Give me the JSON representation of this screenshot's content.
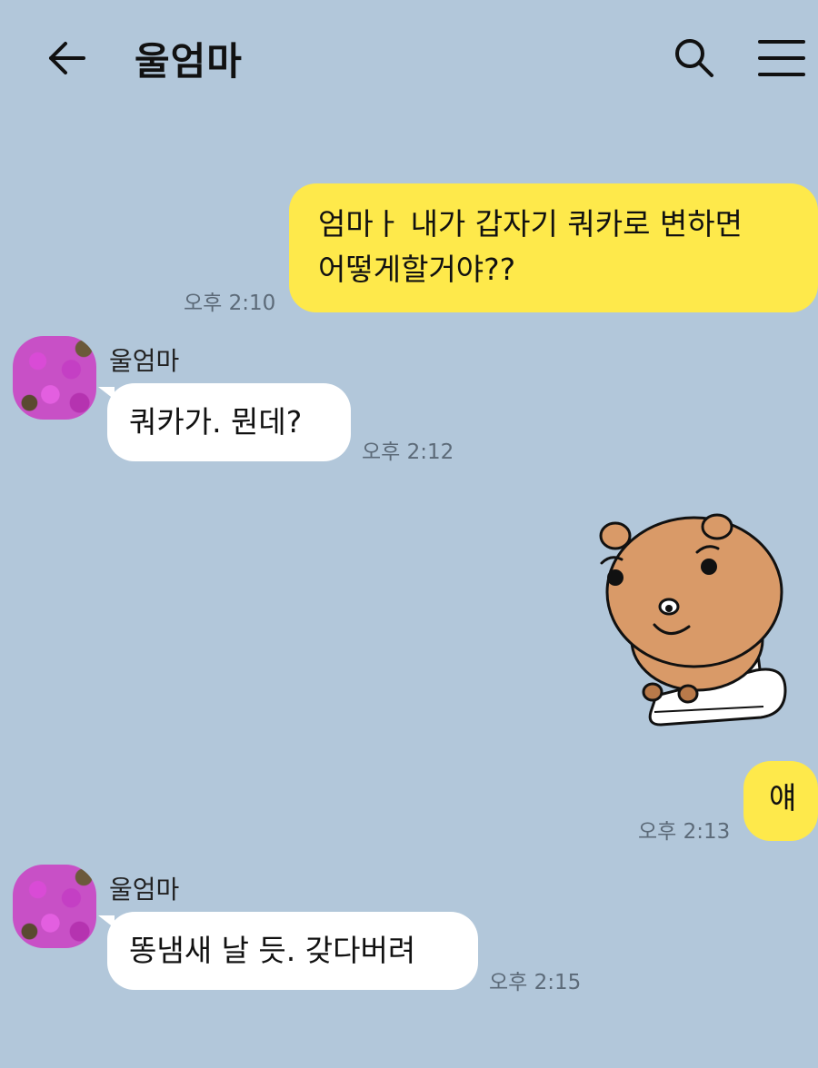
{
  "header": {
    "title": "울엄마",
    "back_icon": "arrow-left-icon",
    "search_icon": "search-icon",
    "menu_icon": "menu-icon"
  },
  "messages": [
    {
      "side": "mine",
      "lines": [
        "엄마ㅏ 내가 갑자기 쿼카로 변하면",
        "어떻게할거야??"
      ],
      "time": "오후 2:10"
    },
    {
      "side": "theirs",
      "sender": "울엄마",
      "text": "쿼카가. 뭔데?",
      "time": "오후 2:12"
    },
    {
      "side": "mine",
      "type": "sticker",
      "sticker": "quokka-on-toilet-sticker"
    },
    {
      "side": "mine",
      "text": "얘",
      "time": "오후 2:13"
    },
    {
      "side": "theirs",
      "sender": "울엄마",
      "text": "똥냄새 날 듯. 갖다버려",
      "time": "오후 2:15"
    }
  ],
  "colors": {
    "background": "#b2c7da",
    "my_bubble": "#fee94b",
    "their_bubble": "#ffffff"
  }
}
